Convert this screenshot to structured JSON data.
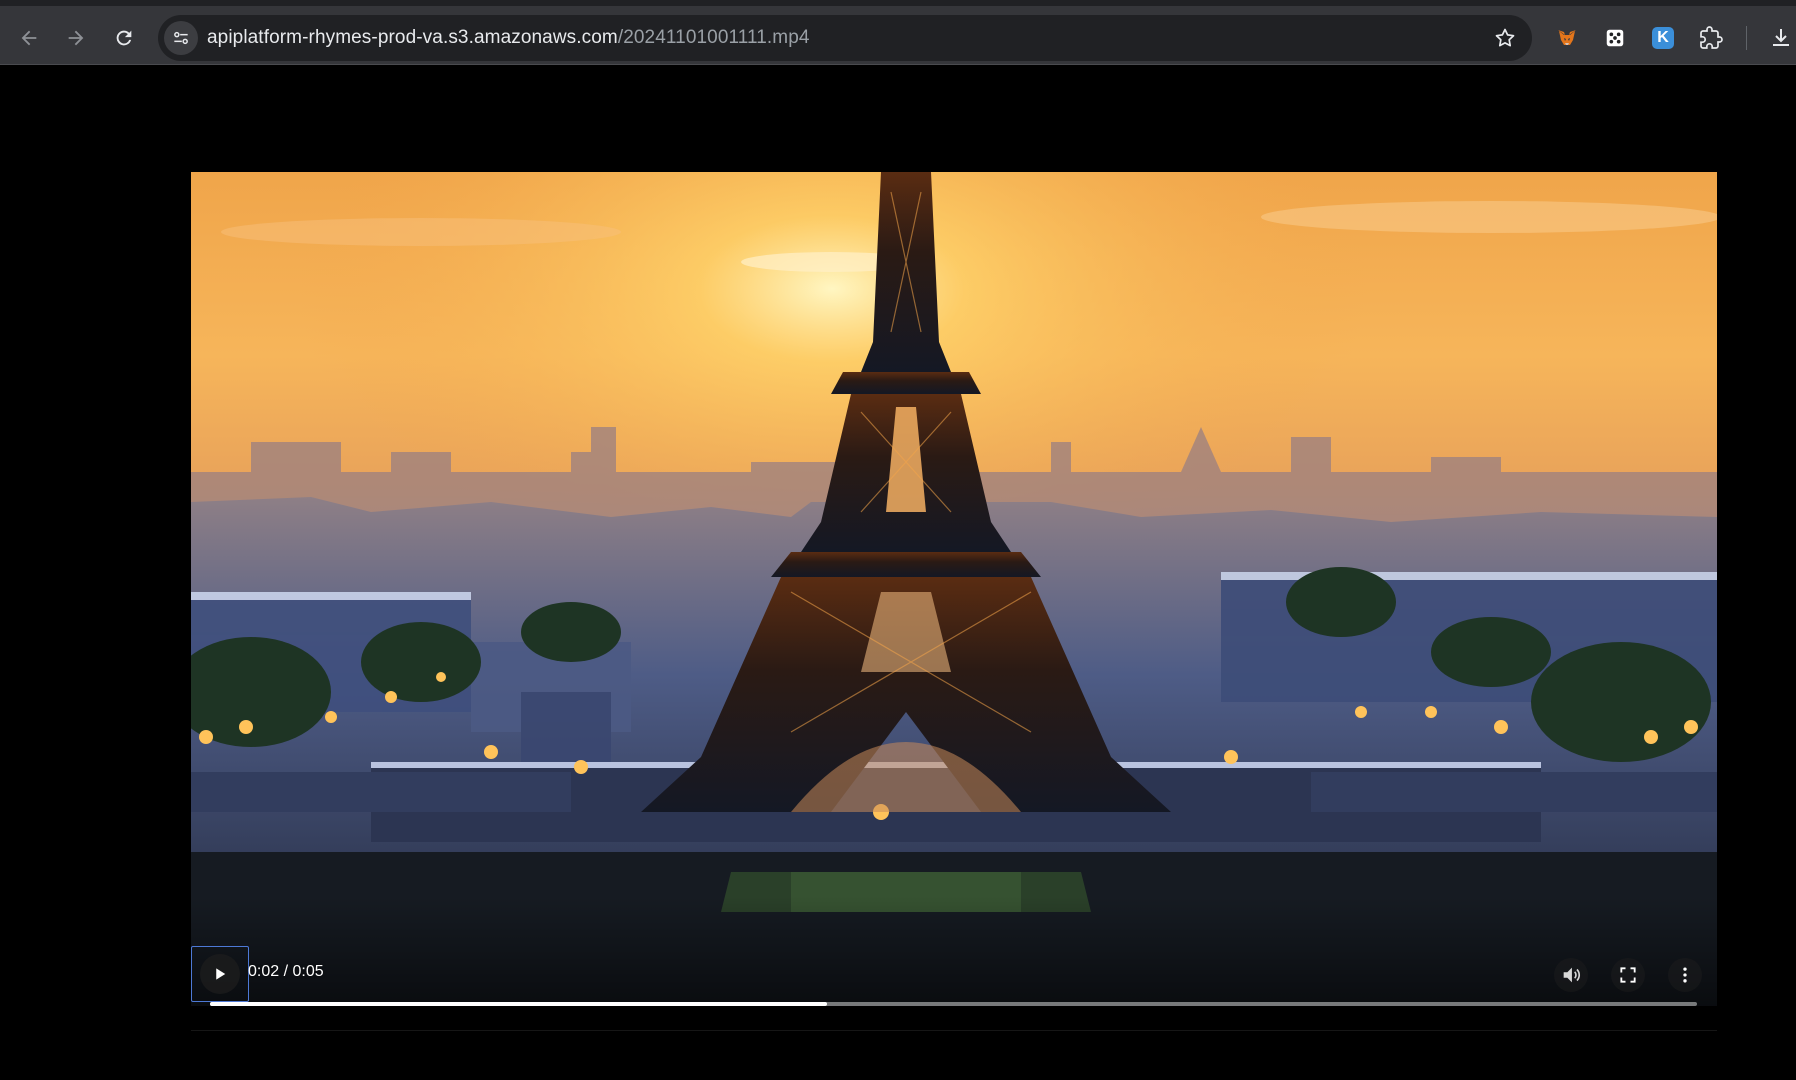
{
  "browser": {
    "url_host": "apiplatform-rhymes-prod-va.s3.amazonaws.com",
    "url_path": "/20241101001111.mp4",
    "icons": {
      "back": "arrow-left-icon",
      "forward": "arrow-right-icon",
      "reload": "reload-icon",
      "site_info": "tune-icon",
      "bookmark": "star-icon",
      "extensions": [
        "metamask-fox-icon",
        "dice-icon",
        "k-extension-icon",
        "puzzle-icon"
      ],
      "download": "download-icon"
    },
    "ext_k_letter": "K",
    "colors": {
      "toolbar": "#35363a",
      "omnibox": "#202124",
      "url_host": "#e8eaed",
      "url_path": "#9aa0a6"
    }
  },
  "video": {
    "current_time": "0:02",
    "duration": "0:05",
    "time_display": "0:02 / 0:05",
    "progress_fraction": 0.415,
    "state": "paused",
    "controls": {
      "play": "play-icon",
      "volume": "volume-icon",
      "fullscreen": "fullscreen-icon",
      "more": "more-vert-icon"
    },
    "colors": {
      "progress_fill": "#ffffff",
      "focus_ring": "#4d79d6"
    }
  }
}
